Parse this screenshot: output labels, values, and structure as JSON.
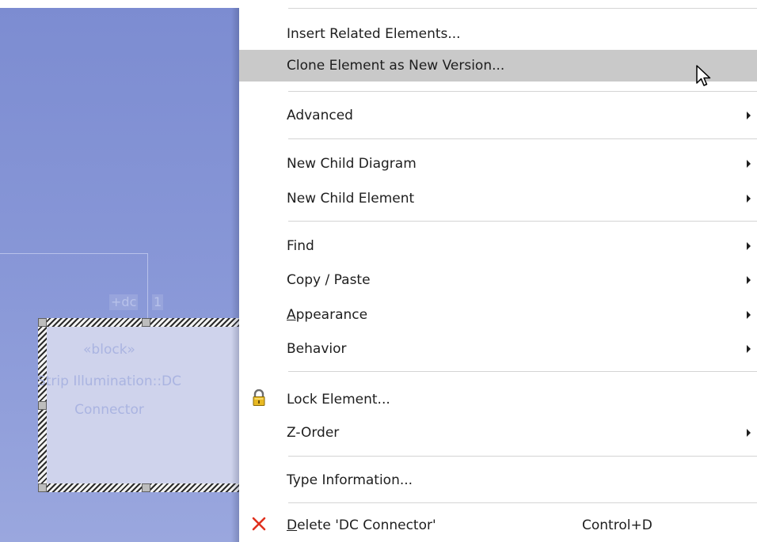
{
  "diagram": {
    "port_label": "+dc",
    "multiplicity_label": "1",
    "block": {
      "stereotype": "«block»",
      "name_line1": "Strip Illumination::DC",
      "name_line2": "Connector"
    }
  },
  "context_menu": {
    "items": [
      {
        "label": "Insert Related Elements...",
        "submenu": false
      },
      {
        "label": "Clone Element as New Version...",
        "submenu": false,
        "highlighted": true
      },
      {
        "label": "Advanced",
        "submenu": true
      },
      {
        "label": "New Child Diagram",
        "submenu": true
      },
      {
        "label": "New Child Element",
        "submenu": true
      },
      {
        "label": "Find",
        "submenu": true
      },
      {
        "label": "Copy / Paste",
        "submenu": true
      },
      {
        "label": "Appearance",
        "submenu": true,
        "underline_first": true
      },
      {
        "label": "Behavior",
        "submenu": true
      },
      {
        "label": "Lock Element...",
        "submenu": false,
        "icon": "padlock-icon"
      },
      {
        "label": "Z-Order",
        "submenu": true
      },
      {
        "label": "Type Information...",
        "submenu": false
      },
      {
        "label": "Delete 'DC Connector'",
        "submenu": false,
        "icon": "delete-x-icon",
        "shortcut": "Control+D",
        "underline_first": true
      }
    ]
  },
  "colors": {
    "highlight": "#c9c9c9",
    "delete_icon": "#e0311e",
    "canvas": "#8897d7"
  }
}
